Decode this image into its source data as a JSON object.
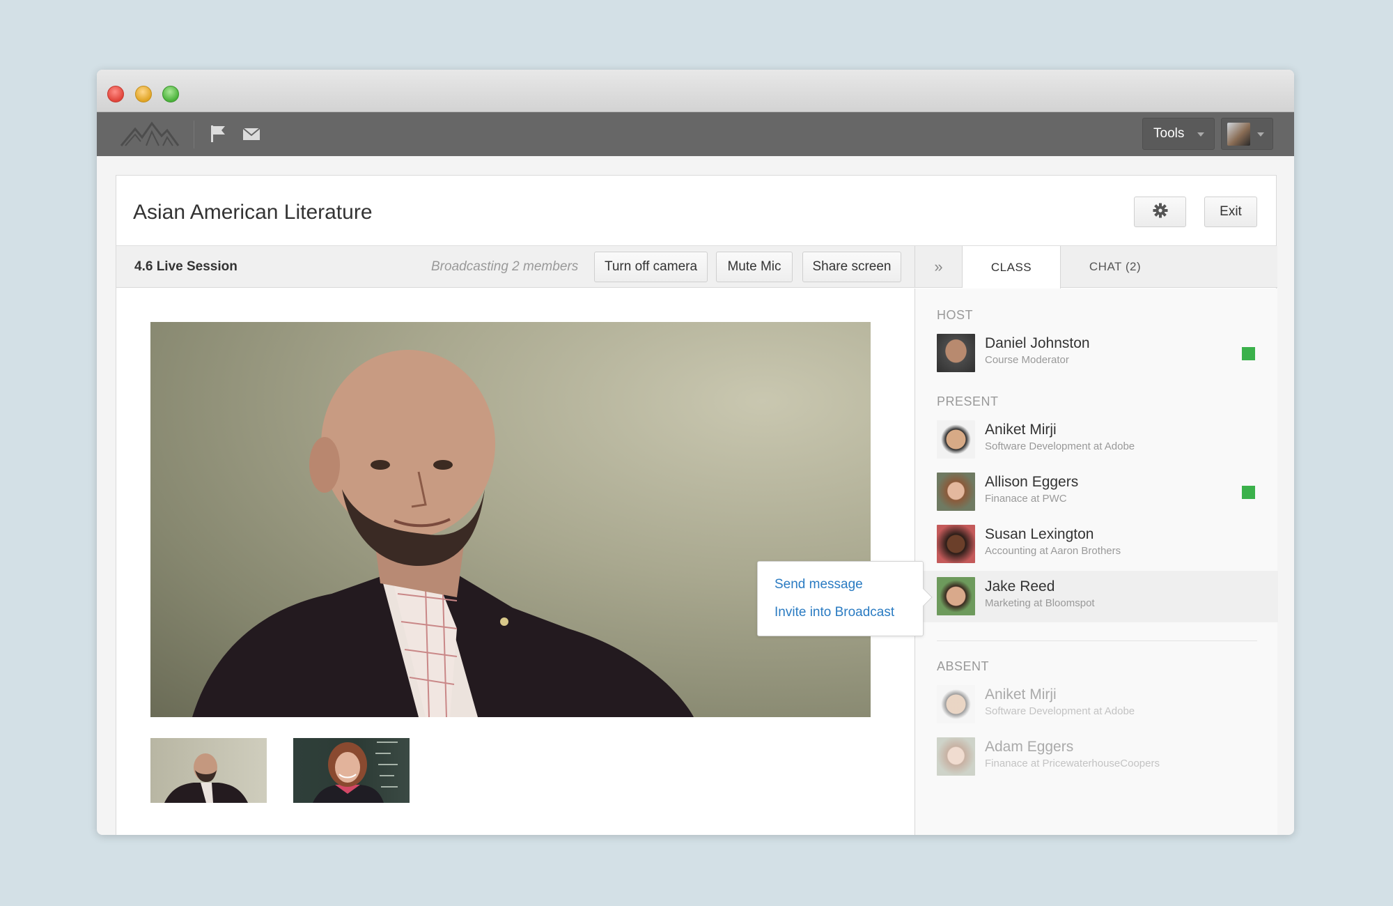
{
  "app": {
    "tools_label": "Tools"
  },
  "page": {
    "title": "Asian American Literature",
    "exit_label": "Exit"
  },
  "toolbar": {
    "session_label": "4.6 Live Session",
    "broadcast_status": "Broadcasting 2 members",
    "camera_button": "Turn off camera",
    "mic_button": "Mute Mic",
    "share_button": "Share screen"
  },
  "tabs": {
    "collapse_glyph": "»",
    "class_label": "CLASS",
    "chat_label": "CHAT (2)"
  },
  "roster": {
    "host_label": "HOST",
    "present_label": "PRESENT",
    "absent_label": "ABSENT",
    "host": [
      {
        "name": "Daniel Johnston",
        "role": "Course Moderator",
        "online": true
      }
    ],
    "present": [
      {
        "name": "Aniket Mirji",
        "role": "Software Development at Adobe",
        "online": false
      },
      {
        "name": "Allison Eggers",
        "role": "Finanace at PWC",
        "online": true
      },
      {
        "name": "Susan Lexington",
        "role": "Accounting at Aaron Brothers",
        "online": false
      },
      {
        "name": "Jake Reed",
        "role": "Marketing at Bloomspot",
        "online": false
      }
    ],
    "absent": [
      {
        "name": "Aniket Mirji",
        "role": "Software Development at Adobe"
      },
      {
        "name": "Adam Eggers",
        "role": "Finanace at PricewaterhouseCoopers"
      }
    ]
  },
  "context_menu": {
    "send_message": "Send message",
    "invite": "Invite into Broadcast"
  },
  "colors": {
    "online": "#3bb14b",
    "link": "#2a7bc2",
    "appbar": "#676767"
  },
  "icons": {
    "logo": "mountain-logo-icon",
    "flag": "flag-icon",
    "mail": "mail-icon",
    "settings": "gear-icon"
  }
}
